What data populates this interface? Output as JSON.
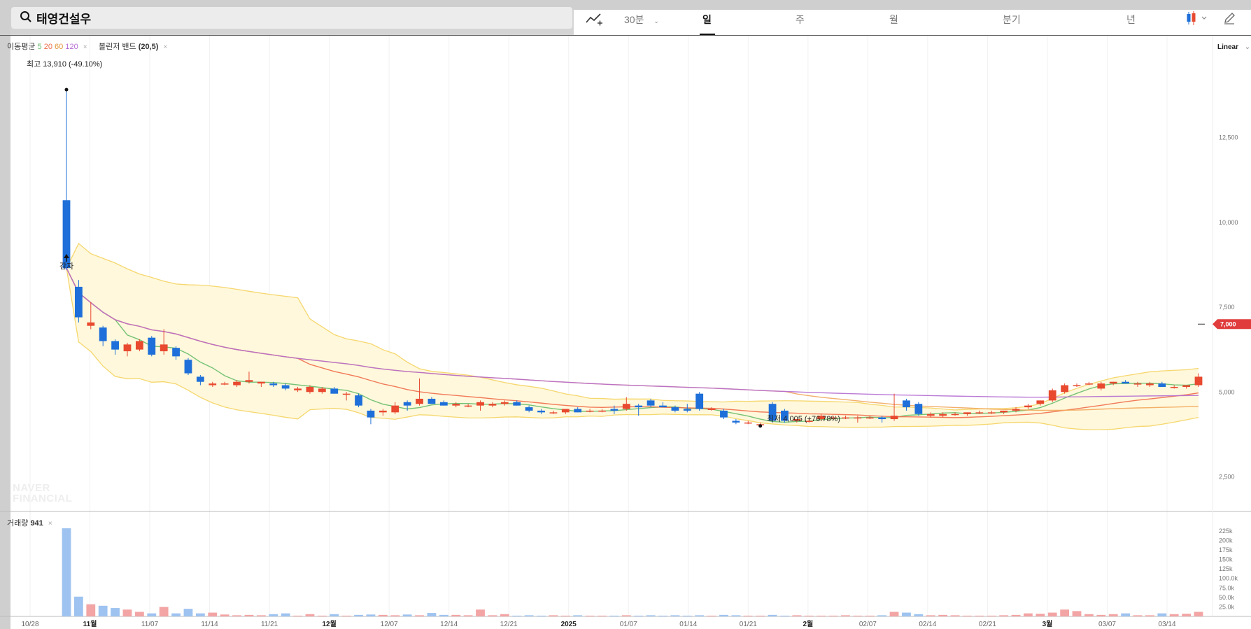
{
  "header": {
    "stock_name": "태영건설우",
    "interval_label": "30분",
    "periods": [
      "일",
      "주",
      "월",
      "분기",
      "년"
    ],
    "active_period": "일"
  },
  "legend": {
    "ma_title": "이동평균",
    "ma_periods": [
      "5",
      "20",
      "60",
      "120"
    ],
    "ma_colors": [
      "#66bb6a",
      "#ef6c4a",
      "#f2a65a",
      "#b46ad1"
    ],
    "bb_title": "볼린저 밴드",
    "bb_params": "(20,5)",
    "close_symbol": "×"
  },
  "annotations": {
    "high": {
      "label": "최고",
      "value": "13,910",
      "pct": "(-49.10%)"
    },
    "low": {
      "label": "최저",
      "value": "4,005",
      "pct": "(+76.78%)"
    },
    "event": "감자",
    "current_price": "7,000"
  },
  "scale_mode": "Linear",
  "volume_legend": {
    "label": "거래량",
    "value": "941"
  },
  "watermark": [
    "NAVER",
    "FINANCIAL"
  ],
  "colors": {
    "up": "#e8492f",
    "down": "#1e6fd9",
    "band_fill": "#fff8dc",
    "band_line": "#f5d76e",
    "price_tag": "#e03c3c",
    "vol_up": "#f3a4a4",
    "vol_down": "#9ec3f0"
  },
  "chart_data": [
    {
      "type": "candlestick",
      "title": "",
      "ylabel": "",
      "ylim": [
        1500,
        15500
      ],
      "y_ticks": [
        2500,
        5000,
        7500,
        10000,
        12500
      ],
      "y_tick_labels": [
        "2,500",
        "5,000",
        "7,500",
        "10,000",
        "12,500"
      ],
      "x_labels": [
        "10/28",
        "11월",
        "11/07",
        "11/14",
        "11/21",
        "12월",
        "12/07",
        "12/14",
        "12/21",
        "2025",
        "01/07",
        "01/14",
        "01/21",
        "2월",
        "02/07",
        "02/14",
        "02/21",
        "3월",
        "03/07",
        "03/14"
      ],
      "x_label_bold": [
        false,
        true,
        false,
        false,
        false,
        true,
        false,
        false,
        false,
        true,
        false,
        false,
        false,
        true,
        false,
        false,
        false,
        true,
        false,
        false
      ],
      "candles": [
        {
          "o": 10650,
          "h": 13910,
          "l": 8600,
          "c": 8650
        },
        {
          "o": 8100,
          "h": 8300,
          "l": 7050,
          "c": 7200
        },
        {
          "o": 6950,
          "h": 7650,
          "l": 6850,
          "c": 7050
        },
        {
          "o": 6900,
          "h": 6950,
          "l": 6350,
          "c": 6500
        },
        {
          "o": 6500,
          "h": 6550,
          "l": 6100,
          "c": 6250
        },
        {
          "o": 6200,
          "h": 6450,
          "l": 6050,
          "c": 6400
        },
        {
          "o": 6250,
          "h": 6550,
          "l": 6200,
          "c": 6500
        },
        {
          "o": 6600,
          "h": 6650,
          "l": 6050,
          "c": 6100
        },
        {
          "o": 6200,
          "h": 6850,
          "l": 6100,
          "c": 6400
        },
        {
          "o": 6300,
          "h": 6350,
          "l": 5950,
          "c": 6050
        },
        {
          "o": 5950,
          "h": 6000,
          "l": 5500,
          "c": 5550
        },
        {
          "o": 5450,
          "h": 5500,
          "l": 5200,
          "c": 5300
        },
        {
          "o": 5200,
          "h": 5300,
          "l": 5150,
          "c": 5250
        },
        {
          "o": 5250,
          "h": 5300,
          "l": 5200,
          "c": 5250
        },
        {
          "o": 5200,
          "h": 5350,
          "l": 5150,
          "c": 5300
        },
        {
          "o": 5300,
          "h": 5600,
          "l": 5250,
          "c": 5350
        },
        {
          "o": 5250,
          "h": 5300,
          "l": 5150,
          "c": 5300
        },
        {
          "o": 5250,
          "h": 5300,
          "l": 5150,
          "c": 5200
        },
        {
          "o": 5200,
          "h": 5250,
          "l": 5050,
          "c": 5100
        },
        {
          "o": 5050,
          "h": 5150,
          "l": 5000,
          "c": 5100
        },
        {
          "o": 5000,
          "h": 5200,
          "l": 4950,
          "c": 5150
        },
        {
          "o": 5000,
          "h": 5150,
          "l": 4950,
          "c": 5100
        },
        {
          "o": 5100,
          "h": 5150,
          "l": 4950,
          "c": 4950
        },
        {
          "o": 4950,
          "h": 5000,
          "l": 4750,
          "c": 4950
        },
        {
          "o": 4900,
          "h": 4950,
          "l": 4550,
          "c": 4600
        },
        {
          "o": 4450,
          "h": 4500,
          "l": 4050,
          "c": 4250
        },
        {
          "o": 4400,
          "h": 4500,
          "l": 4300,
          "c": 4450
        },
        {
          "o": 4400,
          "h": 4700,
          "l": 4350,
          "c": 4600
        },
        {
          "o": 4700,
          "h": 4750,
          "l": 4450,
          "c": 4600
        },
        {
          "o": 4650,
          "h": 5400,
          "l": 4600,
          "c": 4800
        },
        {
          "o": 4800,
          "h": 4850,
          "l": 4650,
          "c": 4650
        },
        {
          "o": 4700,
          "h": 4750,
          "l": 4600,
          "c": 4600
        },
        {
          "o": 4600,
          "h": 4700,
          "l": 4550,
          "c": 4650
        },
        {
          "o": 4600,
          "h": 4650,
          "l": 4550,
          "c": 4600
        },
        {
          "o": 4600,
          "h": 4750,
          "l": 4450,
          "c": 4700
        },
        {
          "o": 4600,
          "h": 4700,
          "l": 4550,
          "c": 4650
        },
        {
          "o": 4650,
          "h": 4750,
          "l": 4600,
          "c": 4700
        },
        {
          "o": 4700,
          "h": 4750,
          "l": 4600,
          "c": 4600
        },
        {
          "o": 4550,
          "h": 4600,
          "l": 4400,
          "c": 4450
        },
        {
          "o": 4450,
          "h": 4500,
          "l": 4350,
          "c": 4400
        },
        {
          "o": 4400,
          "h": 4450,
          "l": 4350,
          "c": 4400
        },
        {
          "o": 4400,
          "h": 4500,
          "l": 4350,
          "c": 4500
        },
        {
          "o": 4500,
          "h": 4550,
          "l": 4400,
          "c": 4400
        },
        {
          "o": 4450,
          "h": 4500,
          "l": 4400,
          "c": 4450
        },
        {
          "o": 4450,
          "h": 4500,
          "l": 4400,
          "c": 4450
        },
        {
          "o": 4500,
          "h": 4600,
          "l": 4350,
          "c": 4450
        },
        {
          "o": 4500,
          "h": 4850,
          "l": 4450,
          "c": 4650
        },
        {
          "o": 4600,
          "h": 4650,
          "l": 4300,
          "c": 4550
        },
        {
          "o": 4750,
          "h": 4800,
          "l": 4550,
          "c": 4600
        },
        {
          "o": 4600,
          "h": 4700,
          "l": 4550,
          "c": 4550
        },
        {
          "o": 4550,
          "h": 4600,
          "l": 4400,
          "c": 4450
        },
        {
          "o": 4500,
          "h": 4650,
          "l": 4400,
          "c": 4450
        },
        {
          "o": 4950,
          "h": 5000,
          "l": 4450,
          "c": 4500
        },
        {
          "o": 4500,
          "h": 4550,
          "l": 4450,
          "c": 4500
        },
        {
          "o": 4450,
          "h": 4500,
          "l": 4200,
          "c": 4250
        },
        {
          "o": 4150,
          "h": 4200,
          "l": 4050,
          "c": 4100
        },
        {
          "o": 4100,
          "h": 4150,
          "l": 4050,
          "c": 4100
        },
        {
          "o": 4050,
          "h": 4100,
          "l": 4000,
          "c": 4050
        },
        {
          "o": 4650,
          "h": 4700,
          "l": 4100,
          "c": 4150
        },
        {
          "o": 4450,
          "h": 4500,
          "l": 4100,
          "c": 4150
        },
        {
          "o": 4150,
          "h": 4200,
          "l": 4100,
          "c": 4200
        },
        {
          "o": 4150,
          "h": 4200,
          "l": 4100,
          "c": 4150
        },
        {
          "o": 4200,
          "h": 4350,
          "l": 4150,
          "c": 4300
        },
        {
          "o": 4250,
          "h": 4300,
          "l": 4200,
          "c": 4250
        },
        {
          "o": 4250,
          "h": 4300,
          "l": 4200,
          "c": 4250
        },
        {
          "o": 4250,
          "h": 4300,
          "l": 4100,
          "c": 4250
        },
        {
          "o": 4250,
          "h": 4300,
          "l": 4200,
          "c": 4250
        },
        {
          "o": 4250,
          "h": 4300,
          "l": 4100,
          "c": 4200
        },
        {
          "o": 4200,
          "h": 4950,
          "l": 4150,
          "c": 4300
        },
        {
          "o": 4750,
          "h": 4800,
          "l": 4450,
          "c": 4550
        },
        {
          "o": 4650,
          "h": 4700,
          "l": 4300,
          "c": 4350
        },
        {
          "o": 4300,
          "h": 4400,
          "l": 4250,
          "c": 4350
        },
        {
          "o": 4300,
          "h": 4400,
          "l": 4250,
          "c": 4350
        },
        {
          "o": 4350,
          "h": 4400,
          "l": 4300,
          "c": 4350
        },
        {
          "o": 4350,
          "h": 4400,
          "l": 4300,
          "c": 4400
        },
        {
          "o": 4400,
          "h": 4450,
          "l": 4350,
          "c": 4400
        },
        {
          "o": 4400,
          "h": 4450,
          "l": 4350,
          "c": 4400
        },
        {
          "o": 4400,
          "h": 4450,
          "l": 4350,
          "c": 4450
        },
        {
          "o": 4450,
          "h": 4550,
          "l": 4400,
          "c": 4500
        },
        {
          "o": 4550,
          "h": 4650,
          "l": 4500,
          "c": 4600
        },
        {
          "o": 4650,
          "h": 4750,
          "l": 4600,
          "c": 4750
        },
        {
          "o": 4750,
          "h": 5100,
          "l": 4700,
          "c": 5050
        },
        {
          "o": 5000,
          "h": 5250,
          "l": 4950,
          "c": 5200
        },
        {
          "o": 5200,
          "h": 5250,
          "l": 5150,
          "c": 5200
        },
        {
          "o": 5250,
          "h": 5300,
          "l": 5200,
          "c": 5250
        },
        {
          "o": 5100,
          "h": 5300,
          "l": 5050,
          "c": 5250
        },
        {
          "o": 5250,
          "h": 5300,
          "l": 5200,
          "c": 5300
        },
        {
          "o": 5300,
          "h": 5350,
          "l": 5250,
          "c": 5250
        },
        {
          "o": 5250,
          "h": 5300,
          "l": 5150,
          "c": 5250
        },
        {
          "o": 5200,
          "h": 5300,
          "l": 5150,
          "c": 5250
        },
        {
          "o": 5250,
          "h": 5300,
          "l": 5150,
          "c": 5150
        },
        {
          "o": 5150,
          "h": 5200,
          "l": 5100,
          "c": 5150
        },
        {
          "o": 5150,
          "h": 5200,
          "l": 5100,
          "c": 5200
        },
        {
          "o": 5200,
          "h": 5550,
          "l": 5150,
          "c": 5450
        }
      ],
      "volume": {
        "ylim": [
          0,
          245000
        ],
        "ticks": [
          25000,
          50000,
          75000,
          100000,
          125000,
          150000,
          175000,
          200000,
          225000
        ],
        "tick_labels": [
          "25.0k",
          "50.0k",
          "75.0k",
          "100.0k",
          "125k",
          "150k",
          "175k",
          "200k",
          "225k"
        ],
        "values": [
          232000,
          52000,
          32000,
          28000,
          22000,
          18000,
          12000,
          8000,
          25000,
          8000,
          20000,
          8000,
          10000,
          5000,
          3000,
          4000,
          3000,
          6000,
          8000,
          2000,
          6000,
          2000,
          6000,
          2000,
          4000,
          5000,
          4000,
          3000,
          5000,
          3000,
          9000,
          4000,
          4000,
          3000,
          18000,
          3000,
          6000,
          2000,
          3000,
          2000,
          3000,
          2000,
          3000,
          2000,
          2000,
          2000,
          3000,
          2000,
          3000,
          2000,
          3000,
          2000,
          3000,
          2000,
          4000,
          3000,
          2000,
          2000,
          4000,
          2000,
          3000,
          2000,
          2000,
          2000,
          3000,
          2000,
          2000,
          3000,
          12000,
          10000,
          6000,
          3000,
          4000,
          3000,
          2000,
          2000,
          2000,
          3000,
          4000,
          8000,
          7000,
          10000,
          18000,
          14000,
          6000,
          4000,
          6000,
          8000,
          3000,
          3000,
          8000,
          6000,
          7000,
          12000
        ]
      }
    }
  ]
}
